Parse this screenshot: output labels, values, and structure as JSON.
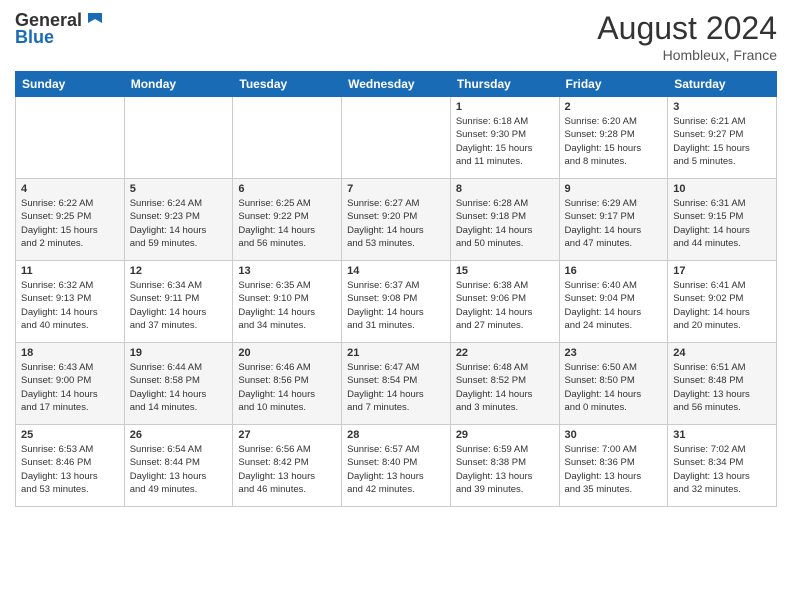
{
  "header": {
    "logo_general": "General",
    "logo_blue": "Blue",
    "month_year": "August 2024",
    "location": "Hombleux, France"
  },
  "days_of_week": [
    "Sunday",
    "Monday",
    "Tuesday",
    "Wednesday",
    "Thursday",
    "Friday",
    "Saturday"
  ],
  "weeks": [
    [
      {
        "day": "",
        "info": ""
      },
      {
        "day": "",
        "info": ""
      },
      {
        "day": "",
        "info": ""
      },
      {
        "day": "",
        "info": ""
      },
      {
        "day": "1",
        "info": "Sunrise: 6:18 AM\nSunset: 9:30 PM\nDaylight: 15 hours\nand 11 minutes."
      },
      {
        "day": "2",
        "info": "Sunrise: 6:20 AM\nSunset: 9:28 PM\nDaylight: 15 hours\nand 8 minutes."
      },
      {
        "day": "3",
        "info": "Sunrise: 6:21 AM\nSunset: 9:27 PM\nDaylight: 15 hours\nand 5 minutes."
      }
    ],
    [
      {
        "day": "4",
        "info": "Sunrise: 6:22 AM\nSunset: 9:25 PM\nDaylight: 15 hours\nand 2 minutes."
      },
      {
        "day": "5",
        "info": "Sunrise: 6:24 AM\nSunset: 9:23 PM\nDaylight: 14 hours\nand 59 minutes."
      },
      {
        "day": "6",
        "info": "Sunrise: 6:25 AM\nSunset: 9:22 PM\nDaylight: 14 hours\nand 56 minutes."
      },
      {
        "day": "7",
        "info": "Sunrise: 6:27 AM\nSunset: 9:20 PM\nDaylight: 14 hours\nand 53 minutes."
      },
      {
        "day": "8",
        "info": "Sunrise: 6:28 AM\nSunset: 9:18 PM\nDaylight: 14 hours\nand 50 minutes."
      },
      {
        "day": "9",
        "info": "Sunrise: 6:29 AM\nSunset: 9:17 PM\nDaylight: 14 hours\nand 47 minutes."
      },
      {
        "day": "10",
        "info": "Sunrise: 6:31 AM\nSunset: 9:15 PM\nDaylight: 14 hours\nand 44 minutes."
      }
    ],
    [
      {
        "day": "11",
        "info": "Sunrise: 6:32 AM\nSunset: 9:13 PM\nDaylight: 14 hours\nand 40 minutes."
      },
      {
        "day": "12",
        "info": "Sunrise: 6:34 AM\nSunset: 9:11 PM\nDaylight: 14 hours\nand 37 minutes."
      },
      {
        "day": "13",
        "info": "Sunrise: 6:35 AM\nSunset: 9:10 PM\nDaylight: 14 hours\nand 34 minutes."
      },
      {
        "day": "14",
        "info": "Sunrise: 6:37 AM\nSunset: 9:08 PM\nDaylight: 14 hours\nand 31 minutes."
      },
      {
        "day": "15",
        "info": "Sunrise: 6:38 AM\nSunset: 9:06 PM\nDaylight: 14 hours\nand 27 minutes."
      },
      {
        "day": "16",
        "info": "Sunrise: 6:40 AM\nSunset: 9:04 PM\nDaylight: 14 hours\nand 24 minutes."
      },
      {
        "day": "17",
        "info": "Sunrise: 6:41 AM\nSunset: 9:02 PM\nDaylight: 14 hours\nand 20 minutes."
      }
    ],
    [
      {
        "day": "18",
        "info": "Sunrise: 6:43 AM\nSunset: 9:00 PM\nDaylight: 14 hours\nand 17 minutes."
      },
      {
        "day": "19",
        "info": "Sunrise: 6:44 AM\nSunset: 8:58 PM\nDaylight: 14 hours\nand 14 minutes."
      },
      {
        "day": "20",
        "info": "Sunrise: 6:46 AM\nSunset: 8:56 PM\nDaylight: 14 hours\nand 10 minutes."
      },
      {
        "day": "21",
        "info": "Sunrise: 6:47 AM\nSunset: 8:54 PM\nDaylight: 14 hours\nand 7 minutes."
      },
      {
        "day": "22",
        "info": "Sunrise: 6:48 AM\nSunset: 8:52 PM\nDaylight: 14 hours\nand 3 minutes."
      },
      {
        "day": "23",
        "info": "Sunrise: 6:50 AM\nSunset: 8:50 PM\nDaylight: 14 hours\nand 0 minutes."
      },
      {
        "day": "24",
        "info": "Sunrise: 6:51 AM\nSunset: 8:48 PM\nDaylight: 13 hours\nand 56 minutes."
      }
    ],
    [
      {
        "day": "25",
        "info": "Sunrise: 6:53 AM\nSunset: 8:46 PM\nDaylight: 13 hours\nand 53 minutes."
      },
      {
        "day": "26",
        "info": "Sunrise: 6:54 AM\nSunset: 8:44 PM\nDaylight: 13 hours\nand 49 minutes."
      },
      {
        "day": "27",
        "info": "Sunrise: 6:56 AM\nSunset: 8:42 PM\nDaylight: 13 hours\nand 46 minutes."
      },
      {
        "day": "28",
        "info": "Sunrise: 6:57 AM\nSunset: 8:40 PM\nDaylight: 13 hours\nand 42 minutes."
      },
      {
        "day": "29",
        "info": "Sunrise: 6:59 AM\nSunset: 8:38 PM\nDaylight: 13 hours\nand 39 minutes."
      },
      {
        "day": "30",
        "info": "Sunrise: 7:00 AM\nSunset: 8:36 PM\nDaylight: 13 hours\nand 35 minutes."
      },
      {
        "day": "31",
        "info": "Sunrise: 7:02 AM\nSunset: 8:34 PM\nDaylight: 13 hours\nand 32 minutes."
      }
    ]
  ]
}
